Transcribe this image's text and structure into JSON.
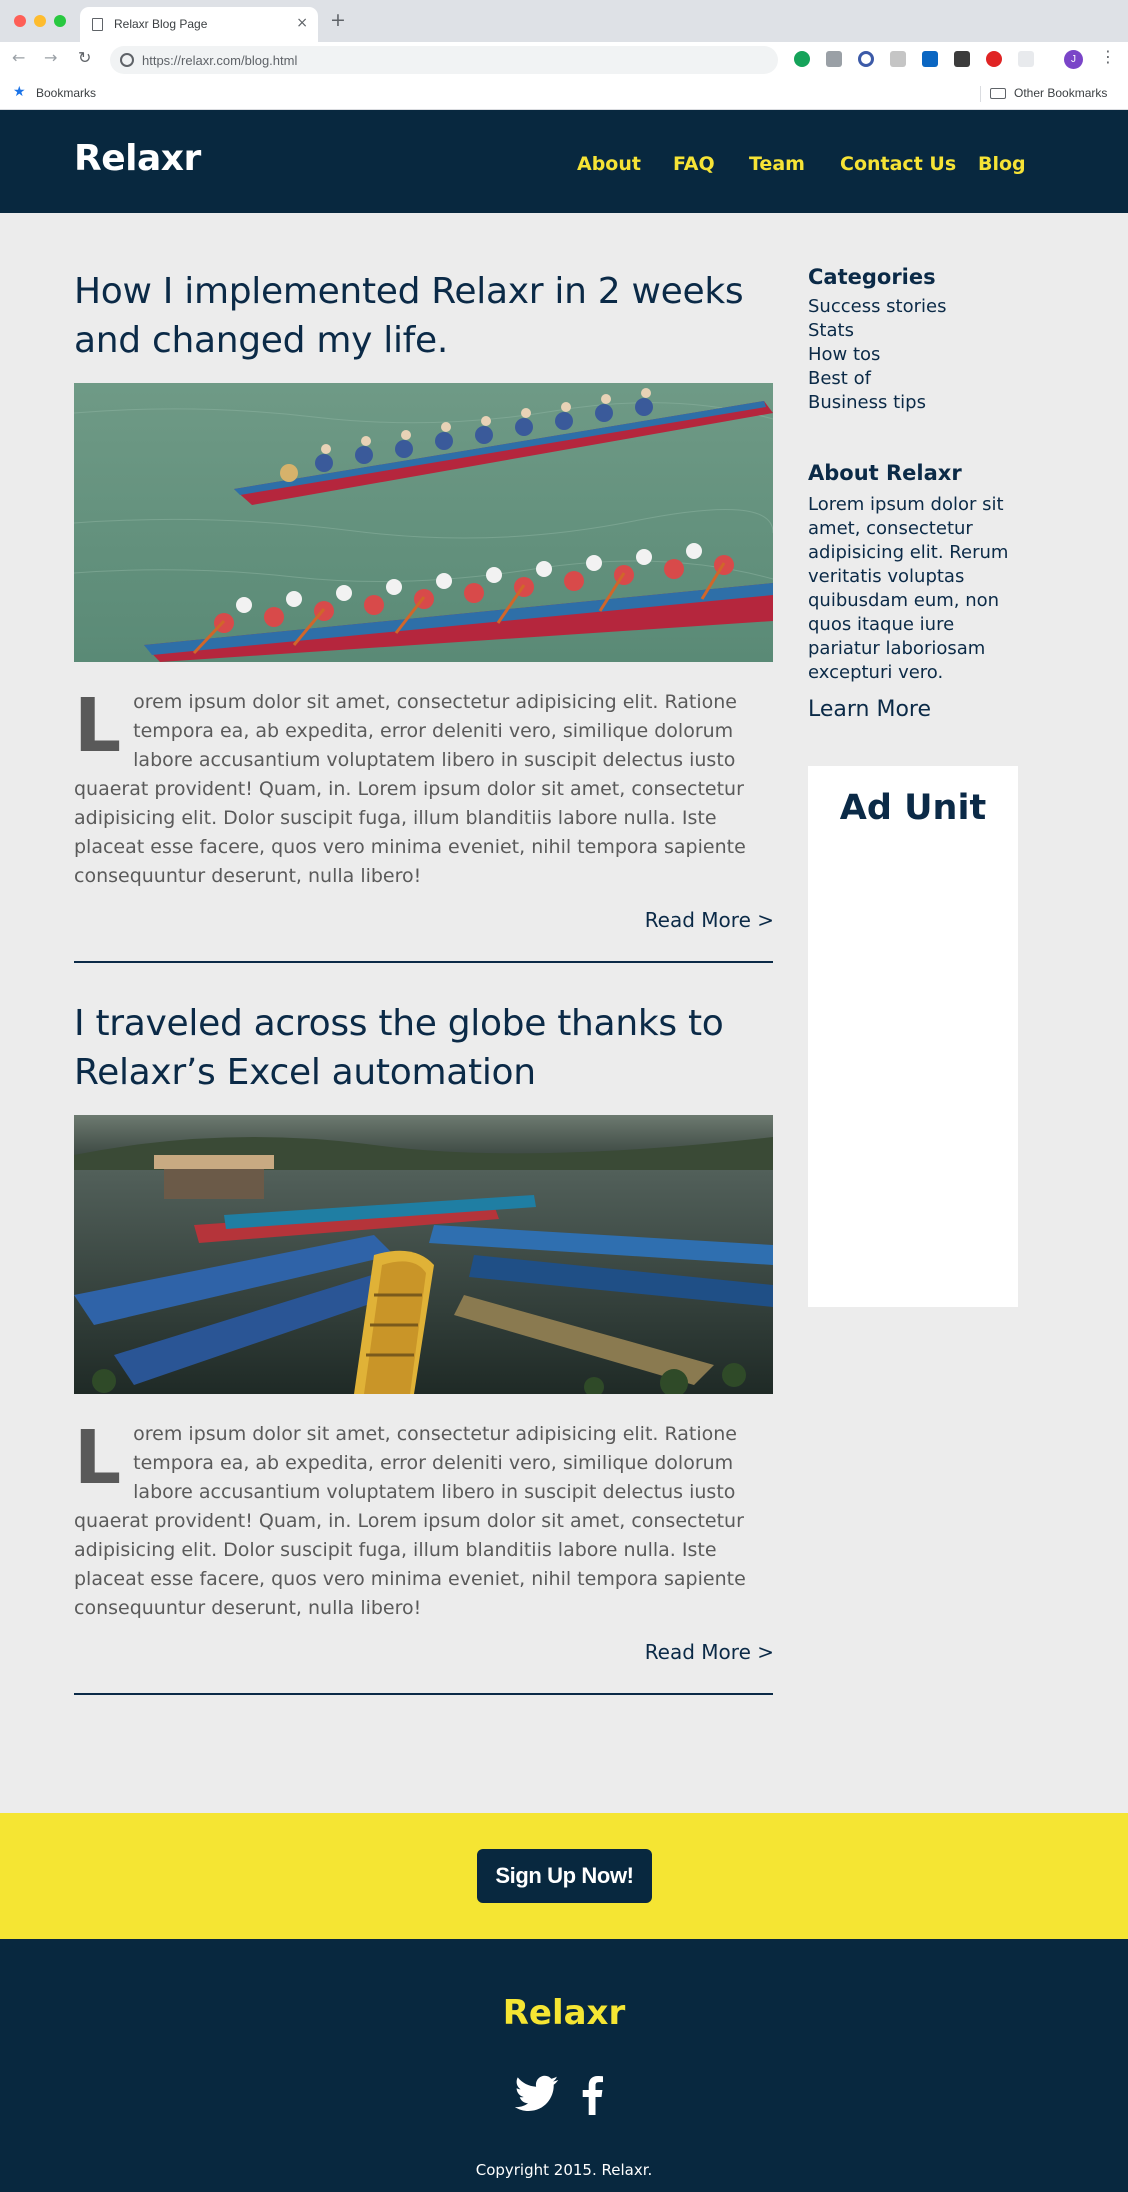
{
  "browser": {
    "tab_title": "Relaxr Blog Page",
    "tab_close": "×",
    "new_tab": "+",
    "url": "https://relaxr.com/blog.html",
    "profile_initial": "J",
    "bookmarks_label": "Bookmarks",
    "other_bookmarks_label": "Other Bookmarks"
  },
  "header": {
    "brand": "Relaxr",
    "nav": [
      "About",
      "FAQ",
      "Team",
      "Contact Us",
      "Blog"
    ]
  },
  "posts": [
    {
      "title": "How I implemented Relaxr in 2 weeks and changed my life.",
      "image": "dragon-boat-race-photo",
      "drop_cap": "L",
      "body": "orem ipsum dolor sit amet, consectetur adipisicing elit. Ratione tempora ea, ab expedita, error deleniti vero, similique dolorum labore accusantium voluptatem libero in suscipit delectus iusto quaerat provident! Quam, in. Lorem ipsum dolor sit amet, consectetur adipisicing elit. Dolor suscipit fuga, illum blanditiis labore nulla. Iste placeat esse facere, quos vero minima eveniet, nihil tempora sapiente consequuntur deserunt, nulla libero!",
      "read_more": "Read More >"
    },
    {
      "title": "I traveled across the globe thanks to Relaxr’s Excel automation",
      "image": "colorful-rowboats-lake-photo",
      "drop_cap": "L",
      "body": "orem ipsum dolor sit amet, consectetur adipisicing elit. Ratione tempora ea, ab expedita, error deleniti vero, similique dolorum labore accusantium voluptatem libero in suscipit delectus iusto quaerat provident! Quam, in. Lorem ipsum dolor sit amet, consectetur adipisicing elit. Dolor suscipit fuga, illum blanditiis labore nulla. Iste placeat esse facere, quos vero minima eveniet, nihil tempora sapiente consequuntur deserunt, nulla libero!",
      "read_more": "Read More >"
    }
  ],
  "sidebar": {
    "categories_heading": "Categories",
    "categories": [
      "Success stories",
      "Stats",
      "How tos",
      "Best of",
      "Business tips"
    ],
    "about_heading": "About Relaxr",
    "about_text": "Lorem ipsum dolor sit amet, consectetur adipisicing elit. Rerum veritatis voluptas quibusdam eum, non quos itaque iure pariatur laboriosam excepturi vero.",
    "learn_more": "Learn More",
    "ad_title": "Ad Unit"
  },
  "cta": {
    "button": "Sign Up Now!"
  },
  "footer": {
    "brand": "Relaxr",
    "social_icons": [
      "twitter-icon",
      "facebook-icon"
    ],
    "copyright": "Copyright 2015. Relaxr."
  },
  "colors": {
    "navy": "#08283f",
    "accent_yellow": "#f5e533",
    "page_background": "#ececec"
  }
}
